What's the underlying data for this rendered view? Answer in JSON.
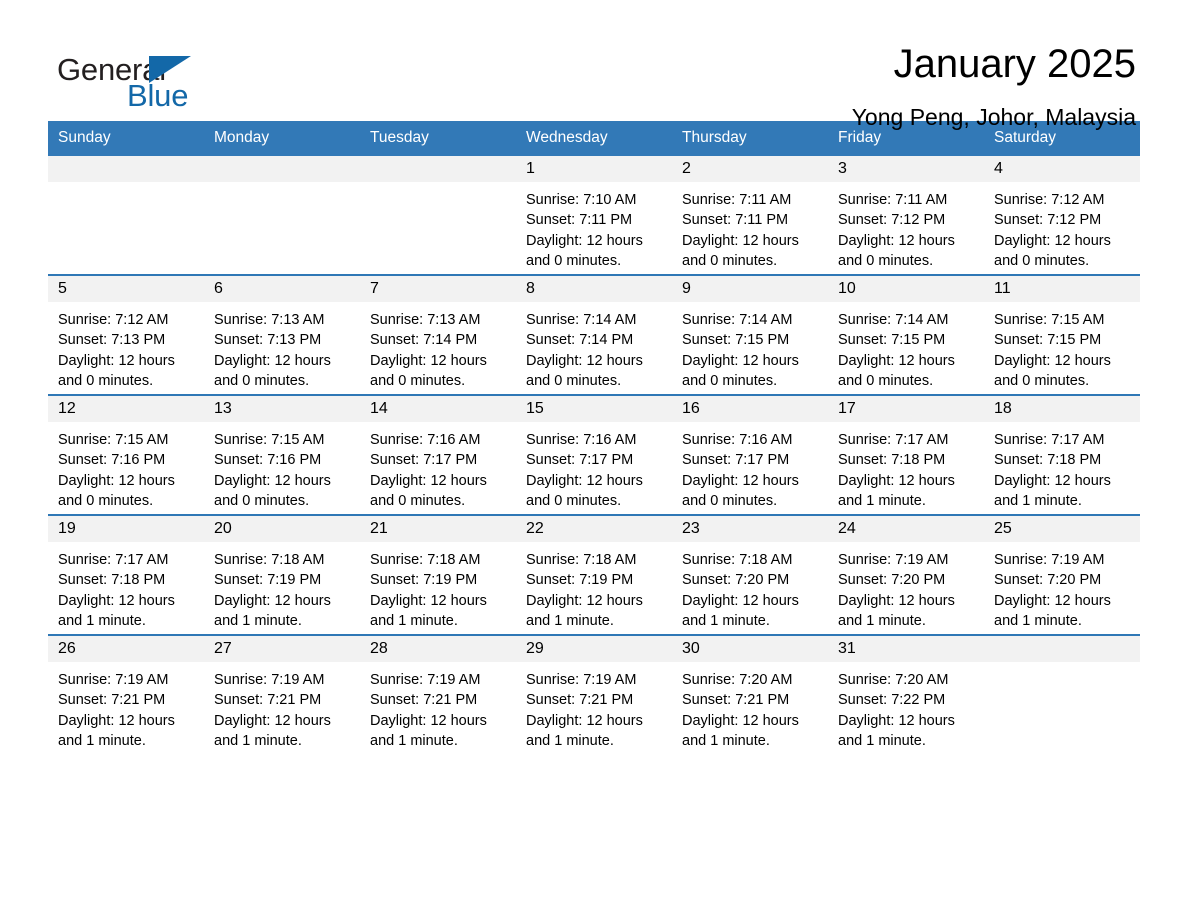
{
  "brand": {
    "name_part1": "General",
    "name_part2": "Blue"
  },
  "header": {
    "month_title": "January 2025",
    "location": "Yong Peng, Johor, Malaysia"
  },
  "colors": {
    "header_blue": "#3279b7",
    "row_divider_blue": "#2f78b6",
    "daynum_band": "#f2f2f2",
    "brand_blue": "#1368a8"
  },
  "calendar": {
    "weekday_headers": [
      "Sunday",
      "Monday",
      "Tuesday",
      "Wednesday",
      "Thursday",
      "Friday",
      "Saturday"
    ],
    "weeks": [
      [
        {
          "day": "",
          "blank": true,
          "sunrise": "",
          "sunset": "",
          "daylight_line1": "",
          "daylight_line2": ""
        },
        {
          "day": "",
          "blank": true,
          "sunrise": "",
          "sunset": "",
          "daylight_line1": "",
          "daylight_line2": ""
        },
        {
          "day": "",
          "blank": true,
          "sunrise": "",
          "sunset": "",
          "daylight_line1": "",
          "daylight_line2": ""
        },
        {
          "day": "1",
          "blank": false,
          "sunrise": "Sunrise: 7:10 AM",
          "sunset": "Sunset: 7:11 PM",
          "daylight_line1": "Daylight: 12 hours",
          "daylight_line2": "and 0 minutes."
        },
        {
          "day": "2",
          "blank": false,
          "sunrise": "Sunrise: 7:11 AM",
          "sunset": "Sunset: 7:11 PM",
          "daylight_line1": "Daylight: 12 hours",
          "daylight_line2": "and 0 minutes."
        },
        {
          "day": "3",
          "blank": false,
          "sunrise": "Sunrise: 7:11 AM",
          "sunset": "Sunset: 7:12 PM",
          "daylight_line1": "Daylight: 12 hours",
          "daylight_line2": "and 0 minutes."
        },
        {
          "day": "4",
          "blank": false,
          "sunrise": "Sunrise: 7:12 AM",
          "sunset": "Sunset: 7:12 PM",
          "daylight_line1": "Daylight: 12 hours",
          "daylight_line2": "and 0 minutes."
        }
      ],
      [
        {
          "day": "5",
          "blank": false,
          "sunrise": "Sunrise: 7:12 AM",
          "sunset": "Sunset: 7:13 PM",
          "daylight_line1": "Daylight: 12 hours",
          "daylight_line2": "and 0 minutes."
        },
        {
          "day": "6",
          "blank": false,
          "sunrise": "Sunrise: 7:13 AM",
          "sunset": "Sunset: 7:13 PM",
          "daylight_line1": "Daylight: 12 hours",
          "daylight_line2": "and 0 minutes."
        },
        {
          "day": "7",
          "blank": false,
          "sunrise": "Sunrise: 7:13 AM",
          "sunset": "Sunset: 7:14 PM",
          "daylight_line1": "Daylight: 12 hours",
          "daylight_line2": "and 0 minutes."
        },
        {
          "day": "8",
          "blank": false,
          "sunrise": "Sunrise: 7:14 AM",
          "sunset": "Sunset: 7:14 PM",
          "daylight_line1": "Daylight: 12 hours",
          "daylight_line2": "and 0 minutes."
        },
        {
          "day": "9",
          "blank": false,
          "sunrise": "Sunrise: 7:14 AM",
          "sunset": "Sunset: 7:15 PM",
          "daylight_line1": "Daylight: 12 hours",
          "daylight_line2": "and 0 minutes."
        },
        {
          "day": "10",
          "blank": false,
          "sunrise": "Sunrise: 7:14 AM",
          "sunset": "Sunset: 7:15 PM",
          "daylight_line1": "Daylight: 12 hours",
          "daylight_line2": "and 0 minutes."
        },
        {
          "day": "11",
          "blank": false,
          "sunrise": "Sunrise: 7:15 AM",
          "sunset": "Sunset: 7:15 PM",
          "daylight_line1": "Daylight: 12 hours",
          "daylight_line2": "and 0 minutes."
        }
      ],
      [
        {
          "day": "12",
          "blank": false,
          "sunrise": "Sunrise: 7:15 AM",
          "sunset": "Sunset: 7:16 PM",
          "daylight_line1": "Daylight: 12 hours",
          "daylight_line2": "and 0 minutes."
        },
        {
          "day": "13",
          "blank": false,
          "sunrise": "Sunrise: 7:15 AM",
          "sunset": "Sunset: 7:16 PM",
          "daylight_line1": "Daylight: 12 hours",
          "daylight_line2": "and 0 minutes."
        },
        {
          "day": "14",
          "blank": false,
          "sunrise": "Sunrise: 7:16 AM",
          "sunset": "Sunset: 7:17 PM",
          "daylight_line1": "Daylight: 12 hours",
          "daylight_line2": "and 0 minutes."
        },
        {
          "day": "15",
          "blank": false,
          "sunrise": "Sunrise: 7:16 AM",
          "sunset": "Sunset: 7:17 PM",
          "daylight_line1": "Daylight: 12 hours",
          "daylight_line2": "and 0 minutes."
        },
        {
          "day": "16",
          "blank": false,
          "sunrise": "Sunrise: 7:16 AM",
          "sunset": "Sunset: 7:17 PM",
          "daylight_line1": "Daylight: 12 hours",
          "daylight_line2": "and 0 minutes."
        },
        {
          "day": "17",
          "blank": false,
          "sunrise": "Sunrise: 7:17 AM",
          "sunset": "Sunset: 7:18 PM",
          "daylight_line1": "Daylight: 12 hours",
          "daylight_line2": "and 1 minute."
        },
        {
          "day": "18",
          "blank": false,
          "sunrise": "Sunrise: 7:17 AM",
          "sunset": "Sunset: 7:18 PM",
          "daylight_line1": "Daylight: 12 hours",
          "daylight_line2": "and 1 minute."
        }
      ],
      [
        {
          "day": "19",
          "blank": false,
          "sunrise": "Sunrise: 7:17 AM",
          "sunset": "Sunset: 7:18 PM",
          "daylight_line1": "Daylight: 12 hours",
          "daylight_line2": "and 1 minute."
        },
        {
          "day": "20",
          "blank": false,
          "sunrise": "Sunrise: 7:18 AM",
          "sunset": "Sunset: 7:19 PM",
          "daylight_line1": "Daylight: 12 hours",
          "daylight_line2": "and 1 minute."
        },
        {
          "day": "21",
          "blank": false,
          "sunrise": "Sunrise: 7:18 AM",
          "sunset": "Sunset: 7:19 PM",
          "daylight_line1": "Daylight: 12 hours",
          "daylight_line2": "and 1 minute."
        },
        {
          "day": "22",
          "blank": false,
          "sunrise": "Sunrise: 7:18 AM",
          "sunset": "Sunset: 7:19 PM",
          "daylight_line1": "Daylight: 12 hours",
          "daylight_line2": "and 1 minute."
        },
        {
          "day": "23",
          "blank": false,
          "sunrise": "Sunrise: 7:18 AM",
          "sunset": "Sunset: 7:20 PM",
          "daylight_line1": "Daylight: 12 hours",
          "daylight_line2": "and 1 minute."
        },
        {
          "day": "24",
          "blank": false,
          "sunrise": "Sunrise: 7:19 AM",
          "sunset": "Sunset: 7:20 PM",
          "daylight_line1": "Daylight: 12 hours",
          "daylight_line2": "and 1 minute."
        },
        {
          "day": "25",
          "blank": false,
          "sunrise": "Sunrise: 7:19 AM",
          "sunset": "Sunset: 7:20 PM",
          "daylight_line1": "Daylight: 12 hours",
          "daylight_line2": "and 1 minute."
        }
      ],
      [
        {
          "day": "26",
          "blank": false,
          "sunrise": "Sunrise: 7:19 AM",
          "sunset": "Sunset: 7:21 PM",
          "daylight_line1": "Daylight: 12 hours",
          "daylight_line2": "and 1 minute."
        },
        {
          "day": "27",
          "blank": false,
          "sunrise": "Sunrise: 7:19 AM",
          "sunset": "Sunset: 7:21 PM",
          "daylight_line1": "Daylight: 12 hours",
          "daylight_line2": "and 1 minute."
        },
        {
          "day": "28",
          "blank": false,
          "sunrise": "Sunrise: 7:19 AM",
          "sunset": "Sunset: 7:21 PM",
          "daylight_line1": "Daylight: 12 hours",
          "daylight_line2": "and 1 minute."
        },
        {
          "day": "29",
          "blank": false,
          "sunrise": "Sunrise: 7:19 AM",
          "sunset": "Sunset: 7:21 PM",
          "daylight_line1": "Daylight: 12 hours",
          "daylight_line2": "and 1 minute."
        },
        {
          "day": "30",
          "blank": false,
          "sunrise": "Sunrise: 7:20 AM",
          "sunset": "Sunset: 7:21 PM",
          "daylight_line1": "Daylight: 12 hours",
          "daylight_line2": "and 1 minute."
        },
        {
          "day": "31",
          "blank": false,
          "sunrise": "Sunrise: 7:20 AM",
          "sunset": "Sunset: 7:22 PM",
          "daylight_line1": "Daylight: 12 hours",
          "daylight_line2": "and 1 minute."
        },
        {
          "day": "",
          "blank": true,
          "sunrise": "",
          "sunset": "",
          "daylight_line1": "",
          "daylight_line2": ""
        }
      ]
    ]
  }
}
